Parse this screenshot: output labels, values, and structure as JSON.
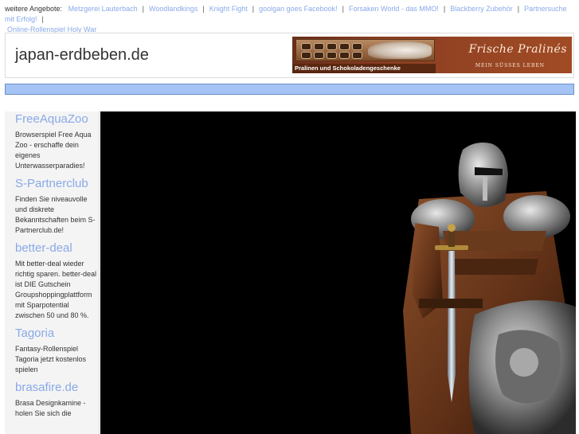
{
  "topbar": {
    "lead": "weitere Angebote:",
    "links": [
      "Metzgerei Lauterbach",
      "Woodlandkings",
      "Knight Fight",
      "goolgan goes Facebook!",
      "Forsaken World - das MMO!",
      "Blackberry Zubehör",
      "Partnersuche mit Erfolg!",
      "Online-Rollenspiel Holy War"
    ],
    "separator": "|"
  },
  "header": {
    "site_title": "japan-erdbeben.de",
    "banner": {
      "brand": "Frische Pralinés",
      "tagline": "Mein süßes Leben",
      "caption": "Pralinen und Schokoladengeschenke"
    }
  },
  "sidebar": {
    "items": [
      {
        "title": "FreeAquaZoo",
        "desc": "Browserspiel Free Aqua Zoo - erschaffe dein eigenes Unterwasserparadies!"
      },
      {
        "title": "S-Partnerclub",
        "desc": "Finden Sie niveauvolle und diskrete Bekanntschaften beim S-Partnerclub.de!"
      },
      {
        "title": "better-deal",
        "desc": "Mit better-deal wieder richtig sparen. better-deal ist DIE Gutschein Groupshoppingplattform mit Sparpotential zwischen 50 und 80 %."
      },
      {
        "title": "Tagoria",
        "desc": "Fantasy-Rollenspiel Tagoria jetzt kostenlos spielen"
      },
      {
        "title": "brasafire.de",
        "desc": "Brasa Designkamine - holen Sie sich die"
      }
    ]
  },
  "colors": {
    "link": "#8aa9e8",
    "navbar": "#a5c3f5",
    "sidebar_bg": "#f4f4f4",
    "banner_bg": "#8c3f22"
  }
}
